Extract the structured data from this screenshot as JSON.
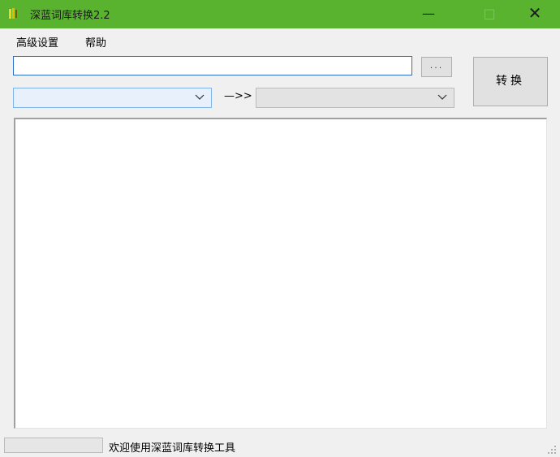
{
  "window": {
    "title": "深蓝词库转换2.2"
  },
  "window_controls": {
    "minimize": "—",
    "maximize": "□",
    "close": "✕"
  },
  "menu": [
    "高级设置",
    "帮助"
  ],
  "toolbar": {
    "path_value": "",
    "browse_label": "...",
    "convert_label": "转换",
    "from_selected": "",
    "arrow": "—>>",
    "to_selected": ""
  },
  "log": {
    "text": ""
  },
  "status": {
    "progress": 0,
    "message": "欢迎使用深蓝词库转换工具"
  },
  "colors": {
    "titlebar": "#59b32f",
    "accent": "#2d6fce"
  }
}
